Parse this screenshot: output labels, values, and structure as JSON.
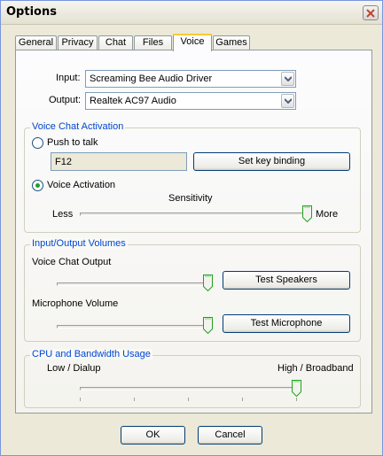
{
  "window": {
    "title": "Options"
  },
  "tabs": [
    {
      "label": "General",
      "active": false
    },
    {
      "label": "Privacy",
      "active": false
    },
    {
      "label": "Chat",
      "active": false
    },
    {
      "label": "Files",
      "active": false
    },
    {
      "label": "Voice",
      "active": true
    },
    {
      "label": "Games",
      "active": false
    }
  ],
  "devices": {
    "input_label": "Input:",
    "input_value": "Screaming Bee Audio Driver",
    "output_label": "Output:",
    "output_value": "Realtek AC97 Audio"
  },
  "activation": {
    "title": "Voice Chat Activation",
    "push_to_talk_label": "Push to talk",
    "push_to_talk_selected": false,
    "key_value": "F12",
    "set_key_label": "Set key binding",
    "voice_activation_label": "Voice Activation",
    "voice_activation_selected": true,
    "sensitivity_label": "Sensitivity",
    "less_label": "Less",
    "more_label": "More",
    "sensitivity_level": 1.0
  },
  "volumes": {
    "title": "Input/Output Volumes",
    "output_label": "Voice Chat Output",
    "output_level": 1.0,
    "test_speakers_label": "Test Speakers",
    "mic_label": "Microphone Volume",
    "mic_level": 1.0,
    "test_mic_label": "Test Microphone"
  },
  "bandwidth": {
    "title": "CPU and Bandwidth Usage",
    "low_label": "Low / Dialup",
    "high_label": "High / Broadband",
    "level": 1.0,
    "tick_count": 5
  },
  "footer": {
    "ok_label": "OK",
    "cancel_label": "Cancel"
  },
  "colors": {
    "group_title": "#0046D5",
    "slider_accent": "#21A121",
    "tab_highlight": "#FFC83C"
  },
  "icons": {
    "close": "close-icon",
    "dropdown": "chevron-down-icon"
  }
}
